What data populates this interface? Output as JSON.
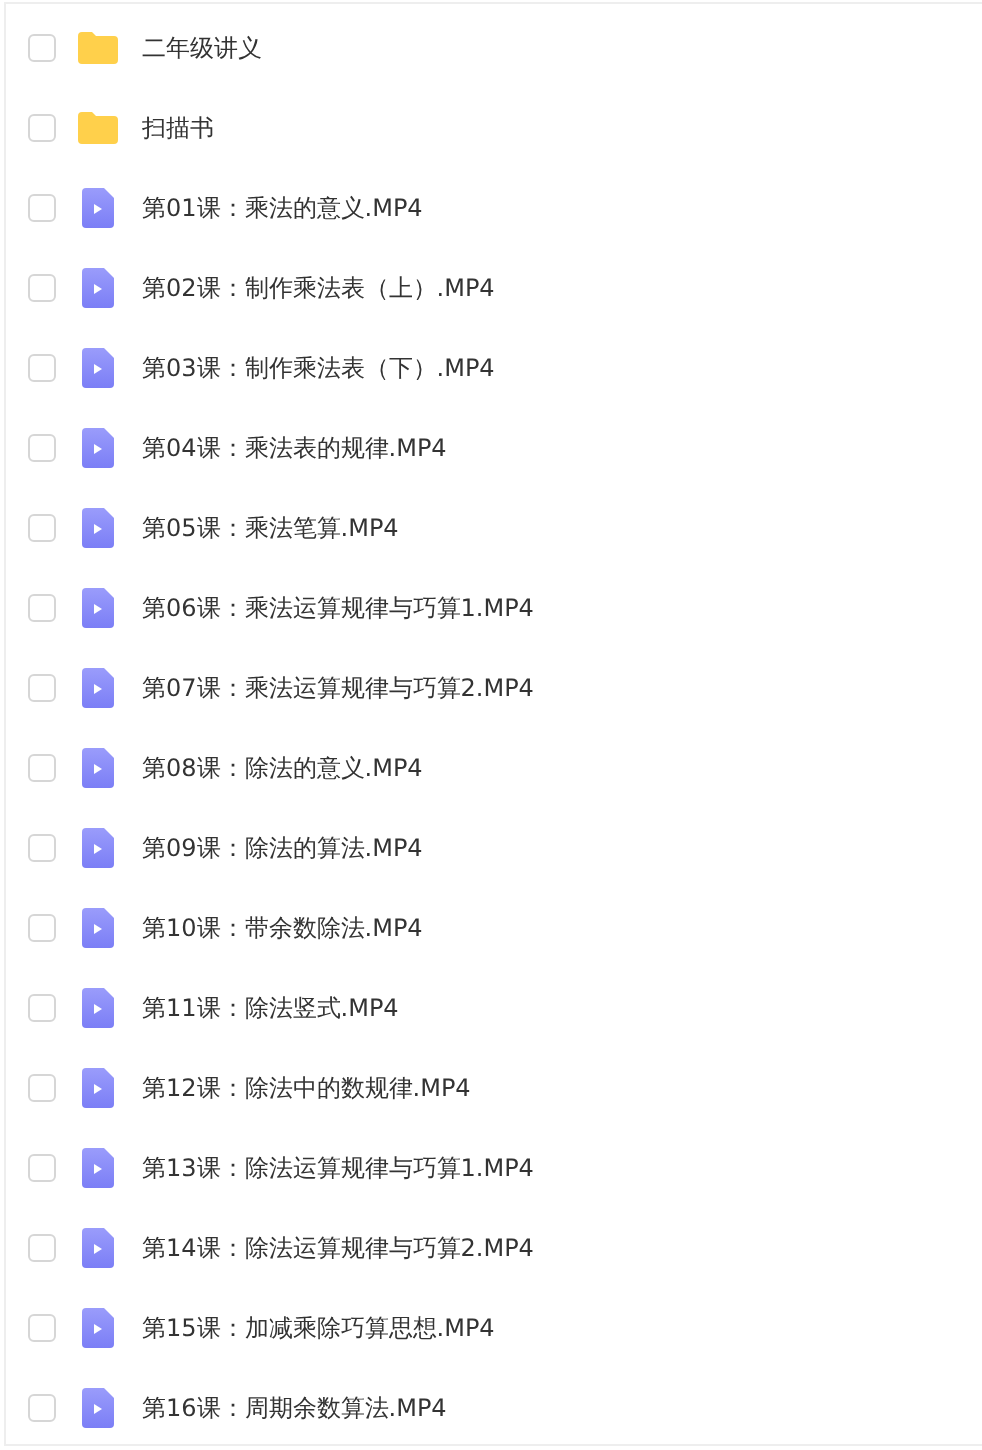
{
  "files": [
    {
      "kind": "folder",
      "name": "二年级讲义",
      "checked": false
    },
    {
      "kind": "folder",
      "name": "扫描书",
      "checked": false
    },
    {
      "kind": "video",
      "name": "第01课：乘法的意义.MP4",
      "checked": false
    },
    {
      "kind": "video",
      "name": "第02课：制作乘法表（上）.MP4",
      "checked": false
    },
    {
      "kind": "video",
      "name": "第03课：制作乘法表（下）.MP4",
      "checked": false
    },
    {
      "kind": "video",
      "name": "第04课：乘法表的规律.MP4",
      "checked": false
    },
    {
      "kind": "video",
      "name": "第05课：乘法笔算.MP4",
      "checked": false
    },
    {
      "kind": "video",
      "name": "第06课：乘法运算规律与巧算1.MP4",
      "checked": false
    },
    {
      "kind": "video",
      "name": "第07课：乘法运算规律与巧算2.MP4",
      "checked": false
    },
    {
      "kind": "video",
      "name": "第08课：除法的意义.MP4",
      "checked": false
    },
    {
      "kind": "video",
      "name": "第09课：除法的算法.MP4",
      "checked": false
    },
    {
      "kind": "video",
      "name": "第10课：带余数除法.MP4",
      "checked": false
    },
    {
      "kind": "video",
      "name": "第11课：除法竖式.MP4",
      "checked": false
    },
    {
      "kind": "video",
      "name": "第12课：除法中的数规律.MP4",
      "checked": false
    },
    {
      "kind": "video",
      "name": "第13课：除法运算规律与巧算1.MP4",
      "checked": false
    },
    {
      "kind": "video",
      "name": "第14课：除法运算规律与巧算2.MP4",
      "checked": false
    },
    {
      "kind": "video",
      "name": "第15课：加减乘除巧算思想.MP4",
      "checked": false
    },
    {
      "kind": "video",
      "name": "第16课：周期余数算法.MP4",
      "checked": false
    }
  ]
}
